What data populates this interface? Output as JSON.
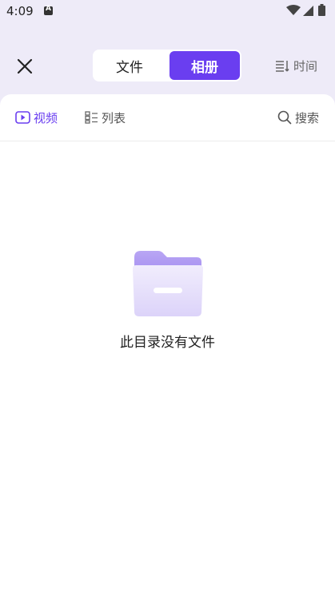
{
  "status": {
    "time": "4:09"
  },
  "header": {
    "tabs": [
      {
        "label": "文件",
        "selected": false
      },
      {
        "label": "相册",
        "selected": true
      }
    ],
    "sort_label": "时间"
  },
  "toolbar": {
    "video_label": "视频",
    "list_label": "列表",
    "search_label": "搜索"
  },
  "empty_state": {
    "message": "此目录没有文件"
  },
  "colors": {
    "accent": "#6a3ef0",
    "background": "#eeebf8",
    "panel": "#ffffff"
  }
}
